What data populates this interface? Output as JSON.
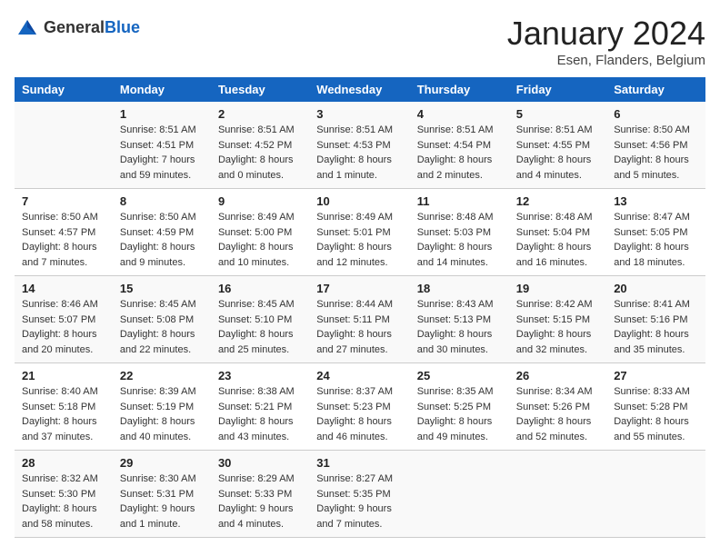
{
  "header": {
    "logo_general": "General",
    "logo_blue": "Blue",
    "month_title": "January 2024",
    "location": "Esen, Flanders, Belgium"
  },
  "days_of_week": [
    "Sunday",
    "Monday",
    "Tuesday",
    "Wednesday",
    "Thursday",
    "Friday",
    "Saturday"
  ],
  "weeks": [
    [
      {
        "day": "",
        "sunrise": "",
        "sunset": "",
        "daylight": ""
      },
      {
        "day": "1",
        "sunrise": "Sunrise: 8:51 AM",
        "sunset": "Sunset: 4:51 PM",
        "daylight": "Daylight: 7 hours and 59 minutes."
      },
      {
        "day": "2",
        "sunrise": "Sunrise: 8:51 AM",
        "sunset": "Sunset: 4:52 PM",
        "daylight": "Daylight: 8 hours and 0 minutes."
      },
      {
        "day": "3",
        "sunrise": "Sunrise: 8:51 AM",
        "sunset": "Sunset: 4:53 PM",
        "daylight": "Daylight: 8 hours and 1 minute."
      },
      {
        "day": "4",
        "sunrise": "Sunrise: 8:51 AM",
        "sunset": "Sunset: 4:54 PM",
        "daylight": "Daylight: 8 hours and 2 minutes."
      },
      {
        "day": "5",
        "sunrise": "Sunrise: 8:51 AM",
        "sunset": "Sunset: 4:55 PM",
        "daylight": "Daylight: 8 hours and 4 minutes."
      },
      {
        "day": "6",
        "sunrise": "Sunrise: 8:50 AM",
        "sunset": "Sunset: 4:56 PM",
        "daylight": "Daylight: 8 hours and 5 minutes."
      }
    ],
    [
      {
        "day": "7",
        "sunrise": "Sunrise: 8:50 AM",
        "sunset": "Sunset: 4:57 PM",
        "daylight": "Daylight: 8 hours and 7 minutes."
      },
      {
        "day": "8",
        "sunrise": "Sunrise: 8:50 AM",
        "sunset": "Sunset: 4:59 PM",
        "daylight": "Daylight: 8 hours and 9 minutes."
      },
      {
        "day": "9",
        "sunrise": "Sunrise: 8:49 AM",
        "sunset": "Sunset: 5:00 PM",
        "daylight": "Daylight: 8 hours and 10 minutes."
      },
      {
        "day": "10",
        "sunrise": "Sunrise: 8:49 AM",
        "sunset": "Sunset: 5:01 PM",
        "daylight": "Daylight: 8 hours and 12 minutes."
      },
      {
        "day": "11",
        "sunrise": "Sunrise: 8:48 AM",
        "sunset": "Sunset: 5:03 PM",
        "daylight": "Daylight: 8 hours and 14 minutes."
      },
      {
        "day": "12",
        "sunrise": "Sunrise: 8:48 AM",
        "sunset": "Sunset: 5:04 PM",
        "daylight": "Daylight: 8 hours and 16 minutes."
      },
      {
        "day": "13",
        "sunrise": "Sunrise: 8:47 AM",
        "sunset": "Sunset: 5:05 PM",
        "daylight": "Daylight: 8 hours and 18 minutes."
      }
    ],
    [
      {
        "day": "14",
        "sunrise": "Sunrise: 8:46 AM",
        "sunset": "Sunset: 5:07 PM",
        "daylight": "Daylight: 8 hours and 20 minutes."
      },
      {
        "day": "15",
        "sunrise": "Sunrise: 8:45 AM",
        "sunset": "Sunset: 5:08 PM",
        "daylight": "Daylight: 8 hours and 22 minutes."
      },
      {
        "day": "16",
        "sunrise": "Sunrise: 8:45 AM",
        "sunset": "Sunset: 5:10 PM",
        "daylight": "Daylight: 8 hours and 25 minutes."
      },
      {
        "day": "17",
        "sunrise": "Sunrise: 8:44 AM",
        "sunset": "Sunset: 5:11 PM",
        "daylight": "Daylight: 8 hours and 27 minutes."
      },
      {
        "day": "18",
        "sunrise": "Sunrise: 8:43 AM",
        "sunset": "Sunset: 5:13 PM",
        "daylight": "Daylight: 8 hours and 30 minutes."
      },
      {
        "day": "19",
        "sunrise": "Sunrise: 8:42 AM",
        "sunset": "Sunset: 5:15 PM",
        "daylight": "Daylight: 8 hours and 32 minutes."
      },
      {
        "day": "20",
        "sunrise": "Sunrise: 8:41 AM",
        "sunset": "Sunset: 5:16 PM",
        "daylight": "Daylight: 8 hours and 35 minutes."
      }
    ],
    [
      {
        "day": "21",
        "sunrise": "Sunrise: 8:40 AM",
        "sunset": "Sunset: 5:18 PM",
        "daylight": "Daylight: 8 hours and 37 minutes."
      },
      {
        "day": "22",
        "sunrise": "Sunrise: 8:39 AM",
        "sunset": "Sunset: 5:19 PM",
        "daylight": "Daylight: 8 hours and 40 minutes."
      },
      {
        "day": "23",
        "sunrise": "Sunrise: 8:38 AM",
        "sunset": "Sunset: 5:21 PM",
        "daylight": "Daylight: 8 hours and 43 minutes."
      },
      {
        "day": "24",
        "sunrise": "Sunrise: 8:37 AM",
        "sunset": "Sunset: 5:23 PM",
        "daylight": "Daylight: 8 hours and 46 minutes."
      },
      {
        "day": "25",
        "sunrise": "Sunrise: 8:35 AM",
        "sunset": "Sunset: 5:25 PM",
        "daylight": "Daylight: 8 hours and 49 minutes."
      },
      {
        "day": "26",
        "sunrise": "Sunrise: 8:34 AM",
        "sunset": "Sunset: 5:26 PM",
        "daylight": "Daylight: 8 hours and 52 minutes."
      },
      {
        "day": "27",
        "sunrise": "Sunrise: 8:33 AM",
        "sunset": "Sunset: 5:28 PM",
        "daylight": "Daylight: 8 hours and 55 minutes."
      }
    ],
    [
      {
        "day": "28",
        "sunrise": "Sunrise: 8:32 AM",
        "sunset": "Sunset: 5:30 PM",
        "daylight": "Daylight: 8 hours and 58 minutes."
      },
      {
        "day": "29",
        "sunrise": "Sunrise: 8:30 AM",
        "sunset": "Sunset: 5:31 PM",
        "daylight": "Daylight: 9 hours and 1 minute."
      },
      {
        "day": "30",
        "sunrise": "Sunrise: 8:29 AM",
        "sunset": "Sunset: 5:33 PM",
        "daylight": "Daylight: 9 hours and 4 minutes."
      },
      {
        "day": "31",
        "sunrise": "Sunrise: 8:27 AM",
        "sunset": "Sunset: 5:35 PM",
        "daylight": "Daylight: 9 hours and 7 minutes."
      },
      {
        "day": "",
        "sunrise": "",
        "sunset": "",
        "daylight": ""
      },
      {
        "day": "",
        "sunrise": "",
        "sunset": "",
        "daylight": ""
      },
      {
        "day": "",
        "sunrise": "",
        "sunset": "",
        "daylight": ""
      }
    ]
  ]
}
